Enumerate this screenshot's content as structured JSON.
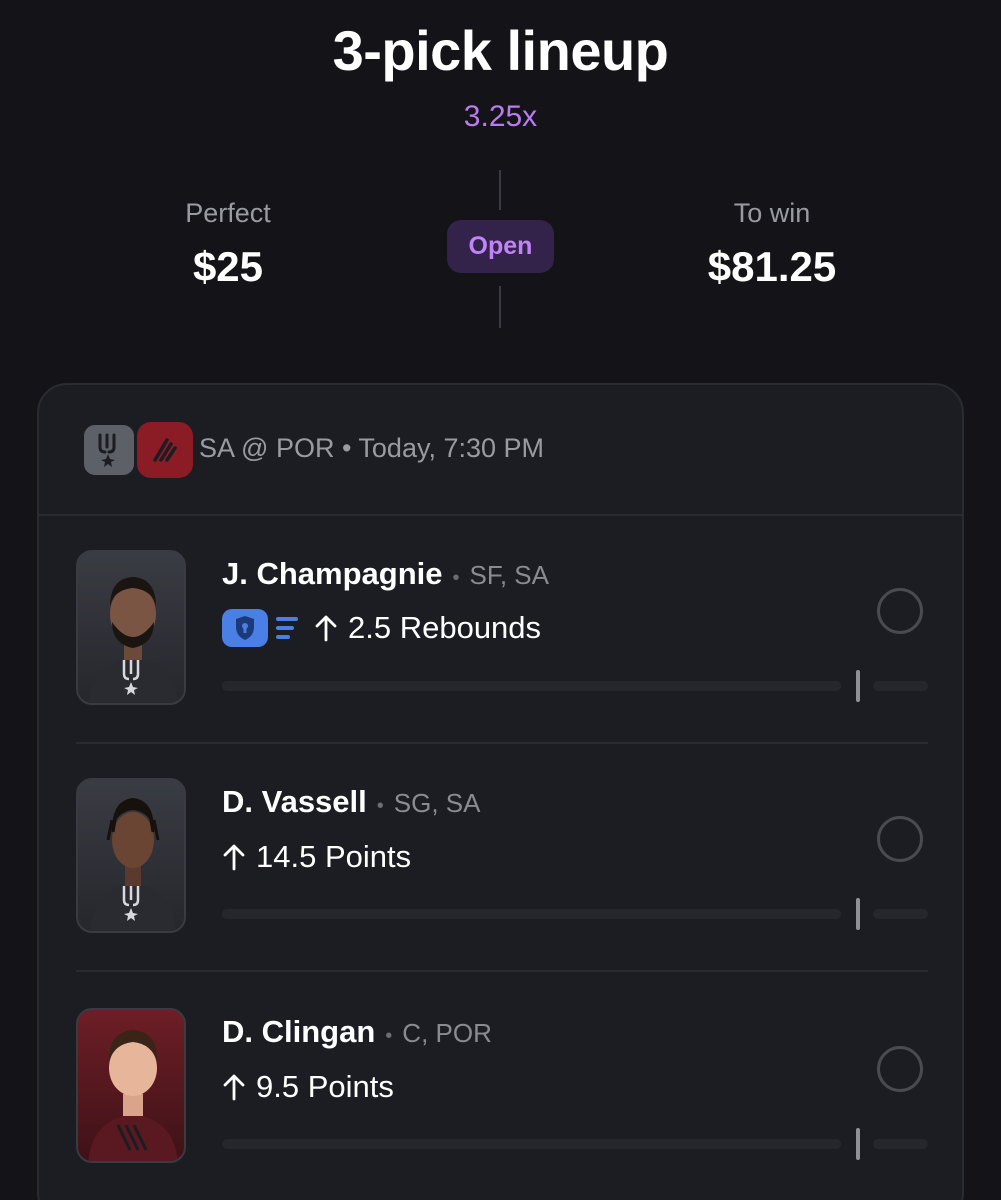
{
  "header": {
    "title": "3-pick lineup",
    "multiplier": "3.25x"
  },
  "summary": {
    "left_label": "Perfect",
    "left_value": "$25",
    "status": "Open",
    "right_label": "To win",
    "right_value": "$81.25"
  },
  "game": {
    "info": "SA @ POR • Today, 7:30 PM",
    "away_logo": "spurs-logo-icon",
    "home_logo": "blazers-logo-icon"
  },
  "picks": [
    {
      "name": "J. Champagnie",
      "meta": "SF, SA",
      "prop": "2.5 Rebounds",
      "direction": "arrow-up-icon",
      "badge": "shield-lock-icon",
      "team_color": "#3a3c43"
    },
    {
      "name": "D. Vassell",
      "meta": "SG, SA",
      "prop": "14.5 Points",
      "direction": "arrow-up-icon",
      "team_color": "#3a3c43"
    },
    {
      "name": "D. Clingan",
      "meta": "C, POR",
      "prop": "9.5 Points",
      "direction": "arrow-up-icon",
      "team_color": "#6d1e26"
    }
  ],
  "colors": {
    "background": "#141418",
    "accent_purple": "#b97cf0",
    "status_pill_bg": "#33224a",
    "shield_blue": "#4a7fe6",
    "card_bg": "#1c1d22"
  }
}
